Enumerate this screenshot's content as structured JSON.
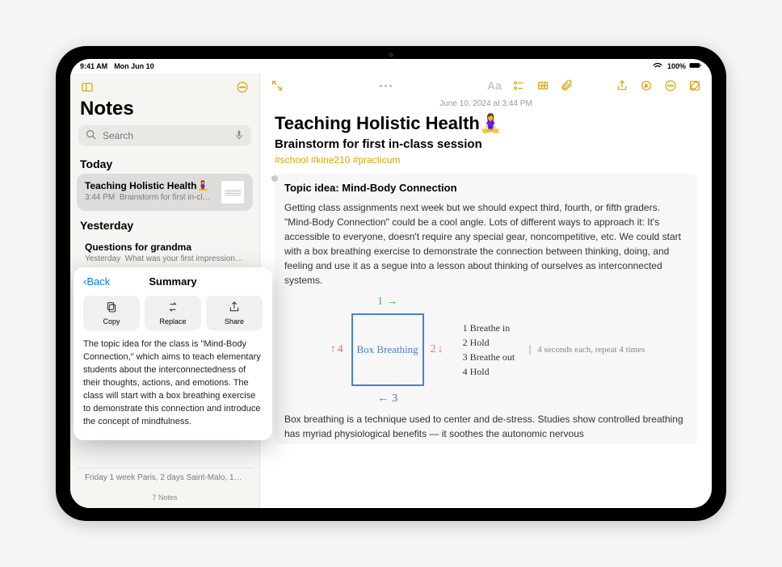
{
  "status": {
    "time": "9:41 AM",
    "date": "Mon Jun 10",
    "battery": "100%"
  },
  "sidebar": {
    "title": "Notes",
    "search_placeholder": "Search",
    "sections": {
      "today": "Today",
      "yesterday": "Yesterday"
    },
    "items": [
      {
        "title": "Teaching Holistic Health🧘‍♀️",
        "time": "3:44 PM",
        "preview": "Brainstorm for first in-cla…"
      },
      {
        "title": "Questions for grandma",
        "time": "Yesterday",
        "preview": "What was your first impression…"
      }
    ],
    "bottom_item": "Friday  1 week Paris, 2 days Saint-Malo, 1…",
    "count": "7 Notes"
  },
  "popup": {
    "back": "Back",
    "title": "Summary",
    "buttons": {
      "copy": "Copy",
      "replace": "Replace",
      "share": "Share"
    },
    "body": "The topic idea for the class is \"Mind-Body Connection,\" which aims to teach elementary students about the interconnectedness of their thoughts, actions, and emotions. The class will start with a box breathing exercise to demonstrate this connection and introduce the concept of mindfulness."
  },
  "doc": {
    "date": "June 10, 2024 at 3:44 PM",
    "title": "Teaching Holistic Health🧘‍♀️",
    "subtitle": "Brainstorm for first in-class session",
    "tags": [
      "#school",
      "#kine210",
      "#practicum"
    ],
    "topic": "Topic idea: Mind-Body Connection",
    "para1": "Getting class assignments next week but we should expect third, fourth, or fifth graders. \"Mind-Body Connection\" could be a cool angle. Lots of different ways to approach it: It's accessible to everyone, doesn't require any special gear, noncompetitive, etc. We could start with a box breathing exercise to demonstrate the connection between thinking, doing, and feeling and use it as a segue into a lesson about thinking of ourselves as interconnected systems.",
    "diagram": {
      "box_label": "Box Breathing",
      "sides": {
        "top": "1",
        "right": "2",
        "bottom": "3",
        "left": "4"
      },
      "steps": [
        "1  Breathe in",
        "2  Hold",
        "3  Breathe out",
        "4  Hold"
      ],
      "note": "4 seconds each, repeat 4 times"
    },
    "para2": "Box breathing is a technique used to center and de-stress. Studies show controlled breathing has myriad physiological benefits — it soothes the autonomic nervous"
  }
}
